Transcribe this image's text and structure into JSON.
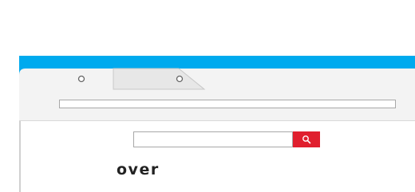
{
  "browser": {
    "accent_color": "#00aaee",
    "tabs": [
      {
        "icon": "circle-icon",
        "state": "active"
      },
      {
        "icon": "circle-icon",
        "state": "inactive"
      }
    ],
    "address_bar": {
      "value": ""
    }
  },
  "search": {
    "value": "",
    "button_icon": "search-icon",
    "button_color": "#e01f2e"
  },
  "content": {
    "word": "over"
  }
}
